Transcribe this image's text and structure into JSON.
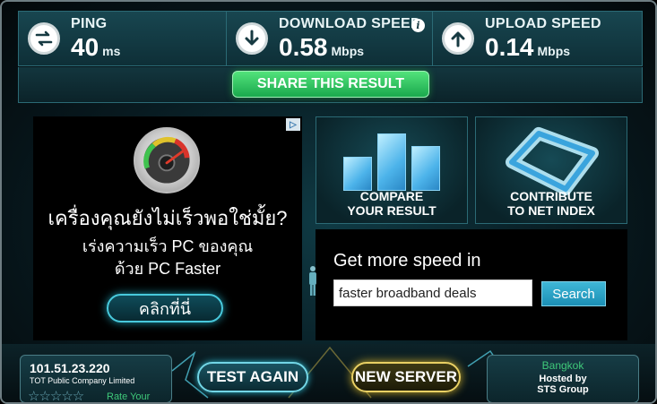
{
  "metrics": {
    "ping": {
      "label": "PING",
      "value": "40",
      "unit": "ms",
      "icon": "swap-arrows-icon"
    },
    "download": {
      "label": "DOWNLOAD SPEED",
      "value": "0.58",
      "unit": "Mbps",
      "icon": "arrow-down-icon",
      "info": "i"
    },
    "upload": {
      "label": "UPLOAD SPEED",
      "value": "0.14",
      "unit": "Mbps",
      "icon": "arrow-up-icon"
    }
  },
  "share": {
    "label": "SHARE THIS RESULT"
  },
  "ad": {
    "adchoices": "▷",
    "headline": "เครื่องคุณยังไม่เร็วพอใช่มั้ย?",
    "line1": "เร่งความเร็ว PC ของคุณ",
    "line2": "ด้วย PC Faster",
    "button": "คลิกที่นี่"
  },
  "panels": {
    "compare": {
      "line1": "COMPARE",
      "line2": "YOUR RESULT"
    },
    "contribute": {
      "line1": "CONTRIBUTE",
      "line2": "TO NET INDEX"
    }
  },
  "search": {
    "title": "Get more speed in",
    "value": "faster broadband deals",
    "button": "Search"
  },
  "isp": {
    "ip": "101.51.23.220",
    "name": "TOT Public Company Limited",
    "stars": "☆☆☆☆☆",
    "rate": "Rate Your"
  },
  "actions": {
    "test_again": "TEST AGAIN",
    "new_server": "NEW SERVER"
  },
  "server": {
    "city": "Bangkok",
    "hosted_line1": "Hosted by",
    "hosted_line2": "STS Group"
  },
  "colors": {
    "accent": "#2cb5cb",
    "share": "#1aa94d",
    "server_gold": "#e9d063",
    "rating_green": "#3fc97a"
  }
}
